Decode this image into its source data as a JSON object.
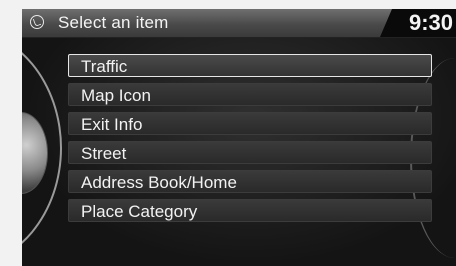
{
  "header": {
    "title": "Select an item",
    "icon": "voice-icon",
    "clock": "9:30"
  },
  "menu": {
    "selected_index": 0,
    "items": [
      {
        "label": "Traffic"
      },
      {
        "label": "Map Icon"
      },
      {
        "label": "Exit Info"
      },
      {
        "label": "Street"
      },
      {
        "label": "Address Book/Home"
      },
      {
        "label": "Place Category"
      }
    ]
  }
}
